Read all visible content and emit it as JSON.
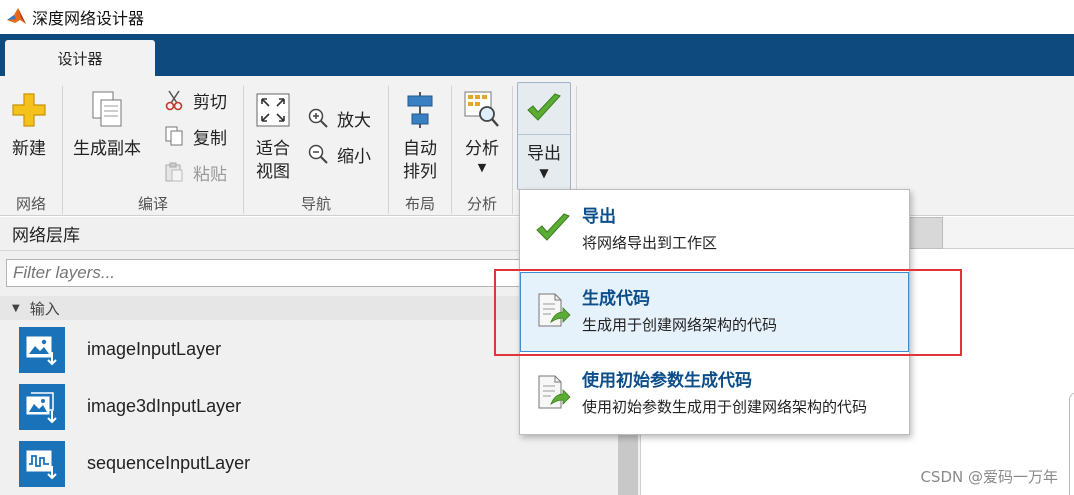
{
  "window": {
    "title": "深度网络设计器"
  },
  "tabs": [
    {
      "label": "设计器",
      "active": true
    }
  ],
  "ribbon": {
    "groups": {
      "network": {
        "label": "网络",
        "new_label": "新建"
      },
      "edit": {
        "label": "编译",
        "duplicate_label": "生成副本",
        "cut_label": "剪切",
        "copy_label": "复制",
        "paste_label": "粘贴"
      },
      "navigate": {
        "label": "导航",
        "fit_line1": "适合",
        "fit_line2": "视图",
        "zoom_in_label": "放大",
        "zoom_out_label": "缩小"
      },
      "layout": {
        "label": "布局",
        "auto_line1": "自动",
        "auto_line2": "排列"
      },
      "analysis": {
        "label": "分析",
        "analyze_label": "分析"
      },
      "export": {
        "label": "导出",
        "caret": "▼"
      }
    }
  },
  "library": {
    "header": "网络层库",
    "filter_placeholder": "Filter layers...",
    "section": {
      "label": "输入",
      "arrow": "▼"
    },
    "layers": [
      {
        "name": "imageInputLayer"
      },
      {
        "name": "image3dInputLayer"
      },
      {
        "name": "sequenceInputLayer"
      }
    ]
  },
  "export_menu": {
    "items": [
      {
        "title": "导出",
        "description": "将网络导出到工作区"
      },
      {
        "title": "生成代码",
        "description": "生成用于创建网络架构的代码"
      },
      {
        "title": "使用初始参数生成代码",
        "description": "使用初始参数生成用于创建网络架构的代码"
      }
    ]
  },
  "watermark": "CSDN @爱码一万年",
  "colors": {
    "tab_bar": "#0e4a7e",
    "ribbon_bg": "#f2f2f2",
    "layer_icon": "#1a73b8",
    "menu_title": "#0b4e8a",
    "highlight_box": "#e0333a"
  }
}
